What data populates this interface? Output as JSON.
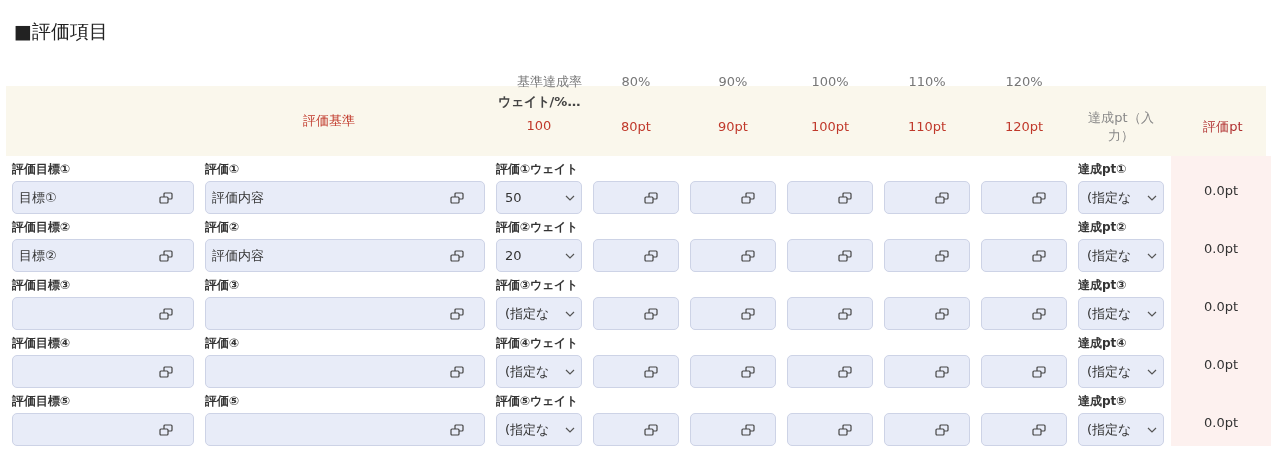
{
  "title": "■評価項目",
  "header": {
    "rate_label": "基準達成率",
    "rates": [
      "80%",
      "90%",
      "100%",
      "110%",
      "120%"
    ],
    "weight_header": "ウェイト/%…",
    "weight_total": "100",
    "criteria": "評価基準",
    "points": [
      "80pt",
      "90pt",
      "100pt",
      "110pt",
      "120pt"
    ],
    "achieved_header": "達成pt（入力）",
    "eval_pt_header": "評価pt"
  },
  "rows": [
    {
      "goal_label": "評価目標①",
      "goal": "目標①",
      "eval_label": "評価①",
      "eval": "評価内容",
      "weight_label": "評価①ウェイト",
      "weight": "50",
      "achieved_label": "達成pt①",
      "achieved": "(指定な",
      "eval_pt": "0.0pt"
    },
    {
      "goal_label": "評価目標②",
      "goal": "目標②",
      "eval_label": "評価②",
      "eval": "評価内容",
      "weight_label": "評価②ウェイト",
      "weight": "20",
      "achieved_label": "達成pt②",
      "achieved": "(指定な",
      "eval_pt": "0.0pt"
    },
    {
      "goal_label": "評価目標③",
      "eval_label": "評価③",
      "weight_label": "評価③ウェイト",
      "weight": "(指定な",
      "achieved_label": "達成pt③",
      "achieved": "(指定な",
      "eval_pt": "0.0pt"
    },
    {
      "goal_label": "評価目標④",
      "eval_label": "評価④",
      "weight_label": "評価④ウェイト",
      "weight": "(指定な",
      "achieved_label": "達成pt④",
      "achieved": "(指定な",
      "eval_pt": "0.0pt"
    },
    {
      "goal_label": "評価目標⑤",
      "eval_label": "評価⑤",
      "weight_label": "評価⑤ウェイト",
      "weight": "(指定な",
      "achieved_label": "達成pt⑤",
      "achieved": "(指定な",
      "eval_pt": "0.0pt"
    }
  ]
}
